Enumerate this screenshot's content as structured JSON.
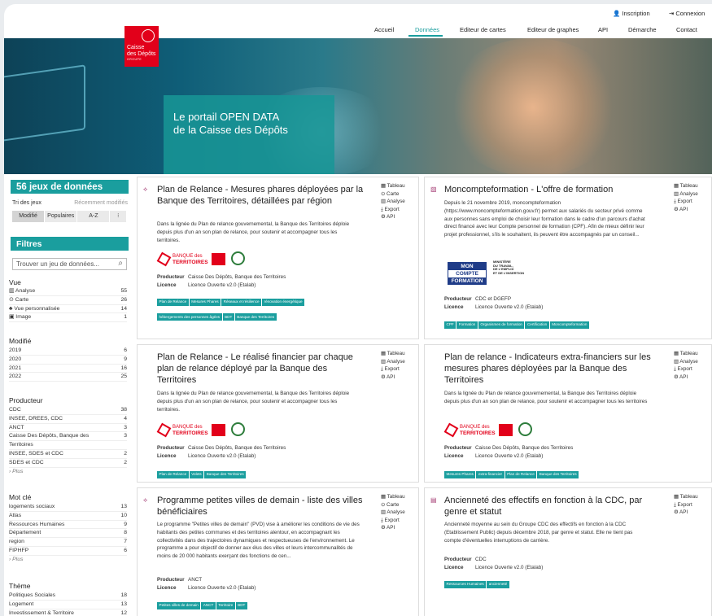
{
  "header": {
    "inscription": "Inscription",
    "connexion": "Connexion",
    "nav": [
      "Accueil",
      "Données",
      "Editeur de cartes",
      "Editeur de graphes",
      "API",
      "Démarche",
      "Contact"
    ],
    "logo": [
      "Caisse",
      "des Dépôts",
      "GROUPE"
    ],
    "hero_line1": "Le portail OPEN DATA",
    "hero_line2": "de la Caisse des Dépôts"
  },
  "sidebar": {
    "count_label": "56 jeux de données",
    "sort_label": "Tri des jeux",
    "sort_value": "Récemment modifiés",
    "sort_options": [
      "Modifié",
      "Populaires",
      "A-Z",
      "⁝"
    ],
    "filters_label": "Filtres",
    "search_placeholder": "Trouver un jeu de données...",
    "vue": {
      "title": "Vue",
      "items": [
        {
          "label": "Analyse",
          "n": "55"
        },
        {
          "label": "Carte",
          "n": "26"
        },
        {
          "label": "Vue personnalisée",
          "n": "14"
        },
        {
          "label": "Image",
          "n": "1"
        }
      ]
    },
    "modifie": {
      "title": "Modifié",
      "items": [
        {
          "label": "2019",
          "n": "6"
        },
        {
          "label": "2020",
          "n": "9"
        },
        {
          "label": "2021",
          "n": "16"
        },
        {
          "label": "2022",
          "n": "25"
        }
      ]
    },
    "producteur": {
      "title": "Producteur",
      "items": [
        {
          "label": "CDC",
          "n": "38"
        },
        {
          "label": "INSEE, DREES, CDC",
          "n": "4"
        },
        {
          "label": "ANCT",
          "n": "3"
        },
        {
          "label": "Caisse Des Dépôts, Banque des",
          "n": "3"
        },
        {
          "label": "Territoires",
          "n": ""
        },
        {
          "label": "INSEE, SDES et CDC",
          "n": "2"
        },
        {
          "label": "SDES et CDC",
          "n": "2"
        }
      ],
      "more": "› Plus"
    },
    "motcle": {
      "title": "Mot clé",
      "items": [
        {
          "label": "logements sociaux",
          "n": "13"
        },
        {
          "label": "Atlas",
          "n": "10"
        },
        {
          "label": "Ressources Humaines",
          "n": "9"
        },
        {
          "label": "Département",
          "n": "8"
        },
        {
          "label": "region",
          "n": "7"
        },
        {
          "label": "FIPHFP",
          "n": "6"
        }
      ],
      "more": "› Plus"
    },
    "theme": {
      "title": "Thème",
      "items": [
        {
          "label": "Politiques Sociales",
          "n": "18"
        },
        {
          "label": "Logement",
          "n": "13"
        },
        {
          "label": "Investissement & Territoire",
          "n": "12"
        }
      ]
    }
  },
  "cards": [
    {
      "title": "Plan de Relance - Mesures phares déployées par la Banque des Territoires, détaillées par région",
      "desc": "Dans la lignée du Plan de relance gouvernemental, la Banque des Territoires déploie depuis plus d'un an son plan de relance, pour soutenir et accompagner tous les territoires.",
      "actions": [
        "Tableau",
        "Carte",
        "Analyse",
        "Export",
        "API"
      ],
      "producteur": "Caisse Des Dépôts, Banque des Territoires",
      "licence": "Licence Ouverte v2.0 (Etalab)",
      "tags": [
        "Plan de Relance",
        "Mesures Phares",
        "Réseaux et résilience",
        "rénovation énergétique",
        "hébergements des personnes âgées",
        "BDT",
        "Banque des Territoires"
      ]
    },
    {
      "title": "Moncompteformation - L'offre de formation",
      "desc": "Depuis le 21 novembre 2019, moncompteformation (https://www.moncompteformation.gouv.fr) permet aux salariés du secteur privé comme aux personnes sans emploi de choisir leur formation dans le cadre d'un parcours d'achat direct financé avec leur Compte personnel de formation (CPF). Afin de mieux définir leur projet professionnel, s'ils le souhaitent, ils peuvent être accompagnés par un conseil...",
      "actions": [
        "Tableau",
        "Analyse",
        "Export",
        "API"
      ],
      "producteur": "CDC et DGEFP",
      "licence": "Licence Ouverte v2.0 (Etalab)",
      "tags": [
        "CPF",
        "Formation",
        "Organismes de formation",
        "Certification",
        "Moncompteformation"
      ]
    },
    {
      "title": "Plan de Relance - Le réalisé financier par chaque plan de relance déployé par la Banque des Territoires",
      "desc": "Dans la lignée du Plan de relance gouvernemental, la Banque des Territoires déploie depuis plus d'un an son plan de relance, pour soutenir et accompagner tous les territoires.",
      "actions": [
        "Tableau",
        "Analyse",
        "Export",
        "API"
      ],
      "producteur": "Caisse Des Dépôts, Banque des Territoires",
      "licence": "Licence Ouverte v2.0 (Etalab)",
      "tags": [
        "Plan de Relance",
        "Volets",
        "Banque des Territoires"
      ]
    },
    {
      "title": "Plan de relance - Indicateurs extra-financiers sur les mesures phares déployées par la Banque des Territoires",
      "desc": "Dans la lignée du Plan de relance gouvernemental, la Banque des Territoires déploie depuis plus d'un an son plan de relance, pour soutenir et accompagner tous les territoires",
      "actions": [
        "Tableau",
        "Analyse",
        "Export",
        "API"
      ],
      "producteur": "Caisse Des Dépôts, Banque des Territoires",
      "licence": "Licence Ouverte v2.0 (Etalab)",
      "tags": [
        "Mesures Phares",
        "extra-financier",
        "Plan de Relance",
        "Banque des Territoires"
      ]
    },
    {
      "title": "Programme petites villes de demain - liste des villes bénéficiaires",
      "desc": "Le programme \"Petites villes de demain\" (PVD) vise à améliorer les conditions de vie des habitants des petites communes et des territoires alentour, en accompagnant les collectivités dans des trajectoires dynamiques et respectueuses de l'environnement. Le programme a pour objectif de donner aux élus des villes et leurs intercommunalités de moins de 20 000 habitants exerçant des fonctions de cen...",
      "actions": [
        "Tableau",
        "Carte",
        "Analyse",
        "Export",
        "API"
      ],
      "producteur": "ANCT",
      "licence": "Licence Ouverte v2.0 (Etalab)",
      "tags": [
        "Petites villes de demain",
        "ANCT",
        "Territoire",
        "BDT"
      ]
    },
    {
      "title": "Ancienneté des effectifs en fonction à la CDC, par genre et statut",
      "desc": "Ancienneté moyenne au sein du Groupe CDC des effectifs en fonction à la CDC (Etablissement Public) depuis décembre 2018, par genre et statut. Elle ne tient pas compte d'éventuelles interruptions de carrière.",
      "actions": [
        "Tableau",
        "Export",
        "API"
      ],
      "producteur": "CDC",
      "licence": "Licence Ouverte v2.0 (Etalab)",
      "tags": [
        "Ressources Humaines",
        "ancienneté"
      ]
    }
  ],
  "labels": {
    "producteur": "Producteur",
    "licence": "Licence"
  },
  "banque_logo": {
    "l1": "BANQUE des",
    "l2": "TERRITOIRES"
  },
  "mcf_logo": {
    "l1": "MON",
    "l2": "COMPTE",
    "l3": "FORMATION",
    "ministry": [
      "MINISTÈRE",
      "DU TRAVAIL,",
      "DE L'EMPLOI",
      "ET DE L'INSERTION"
    ]
  }
}
